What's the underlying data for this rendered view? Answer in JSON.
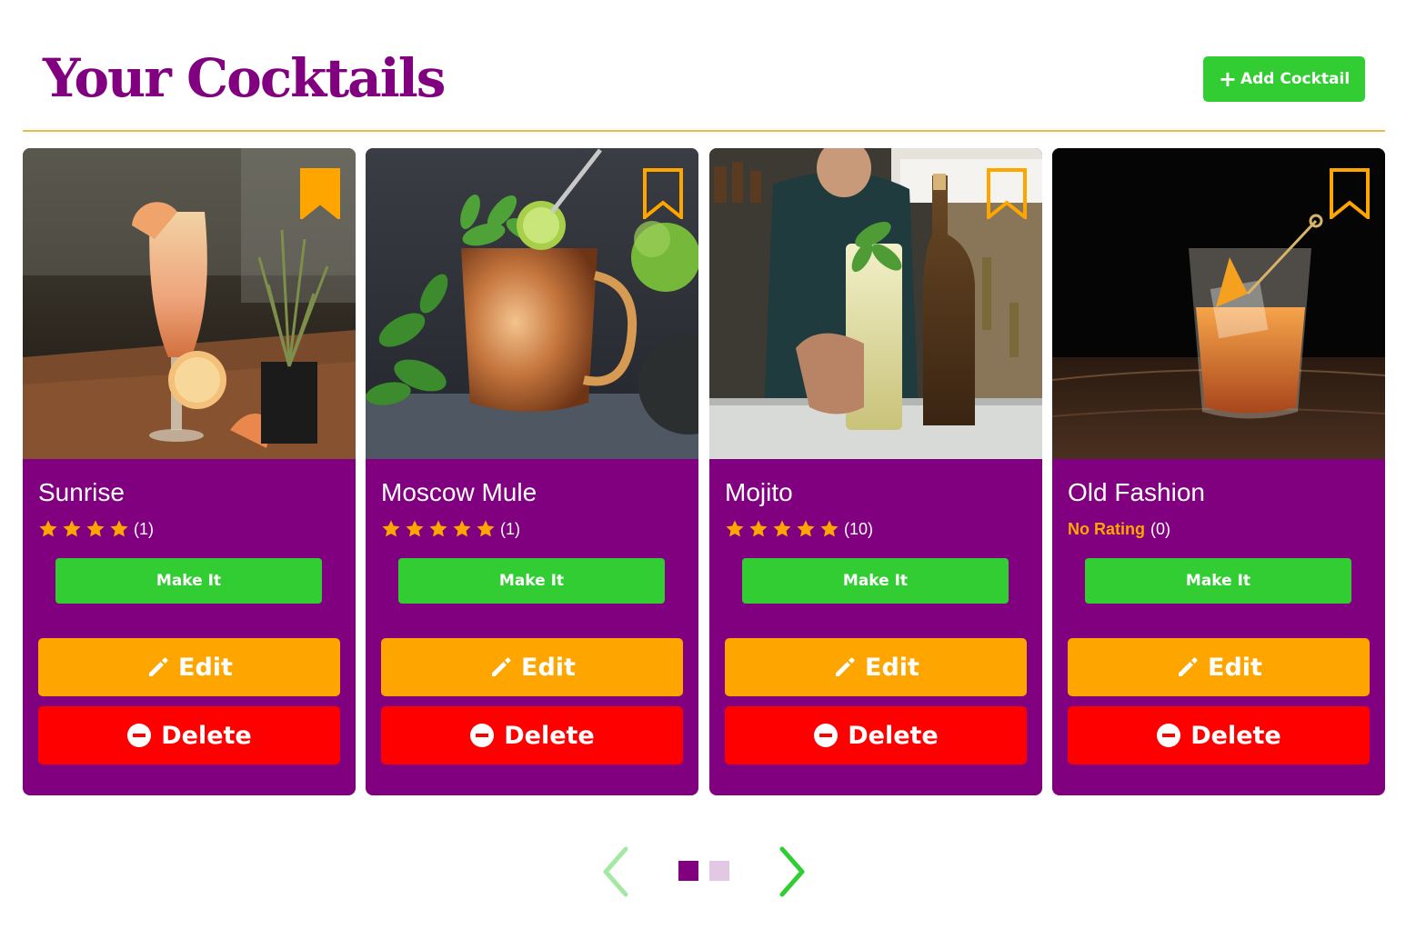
{
  "header": {
    "title": "Your Cocktails",
    "add_button_label": "Add Cocktail"
  },
  "colors": {
    "accent": "#800080",
    "make_button": "#32cd32",
    "edit_button": "#ffa500",
    "delete_button": "#ff0000",
    "star": "#ffa500",
    "divider": "#f0b84a"
  },
  "cards": [
    {
      "name": "Sunrise",
      "stars": 4,
      "rating_count": "(1)",
      "no_rating_label": "",
      "bookmarked": true,
      "make_label": "Make It",
      "edit_label": "Edit",
      "delete_label": "Delete"
    },
    {
      "name": "Moscow Mule",
      "stars": 5,
      "rating_count": "(1)",
      "no_rating_label": "",
      "bookmarked": false,
      "make_label": "Make It",
      "edit_label": "Edit",
      "delete_label": "Delete"
    },
    {
      "name": "Mojito",
      "stars": 5,
      "rating_count": "(10)",
      "no_rating_label": "",
      "bookmarked": false,
      "make_label": "Make It",
      "edit_label": "Edit",
      "delete_label": "Delete"
    },
    {
      "name": "Old Fashion",
      "stars": 0,
      "rating_count": "(0)",
      "no_rating_label": "No Rating",
      "bookmarked": false,
      "make_label": "Make It",
      "edit_label": "Edit",
      "delete_label": "Delete"
    }
  ],
  "pagination": {
    "pages": 2,
    "current_page": 1,
    "prev_enabled": false,
    "next_enabled": true
  },
  "icons": {
    "add": "plus-icon",
    "bookmark": "bookmark-icon",
    "star": "star-icon",
    "edit": "pencil-icon",
    "delete": "minus-circle-icon",
    "prev": "chevron-left-icon",
    "next": "chevron-right-icon"
  }
}
